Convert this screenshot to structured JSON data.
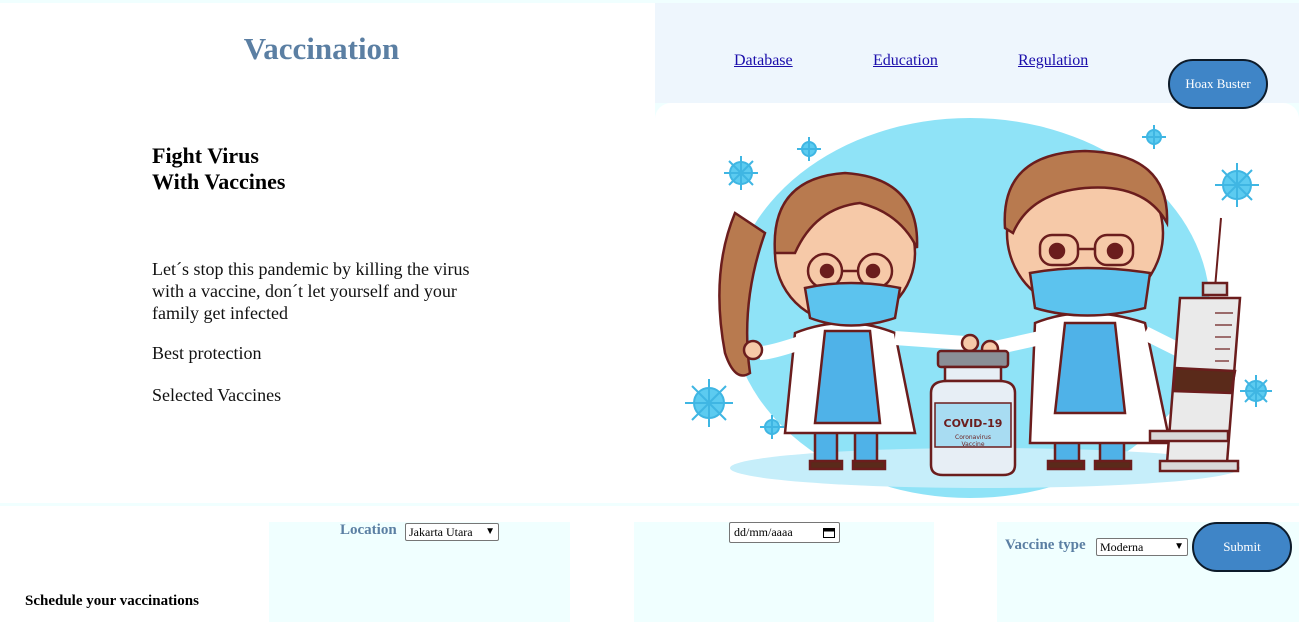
{
  "header": {
    "title": "Vaccination"
  },
  "nav": {
    "links": [
      "Database",
      "Education",
      "Regulation"
    ],
    "hoax_button": "Hoax Buster"
  },
  "hero": {
    "headline_line1": "Fight Virus",
    "headline_line2": "With Vaccines",
    "intro": "Let´s stop this pandemic by killing the virus with a vaccine, don´t let yourself and your family get infected",
    "best_protection": "Best protection",
    "selected_vaccines": "Selected Vaccines",
    "illustration": {
      "vial_label": "COVID-19",
      "vial_sublabel1": "Coronavirus",
      "vial_sublabel2": "Vaccine"
    }
  },
  "booking": {
    "schedule_label": "Schedule your vaccinations",
    "location_label": "Location",
    "location_value": "Jakarta Utara",
    "date_placeholder": "dd/mm/aaaa",
    "vaccine_type_label": "Vaccine type",
    "vaccine_type_value": "Moderna",
    "submit_label": "Submit"
  },
  "colors": {
    "title_color": "#5b7fa3",
    "button_color": "#3f85c7",
    "panel_bg": "#f0ffff",
    "nav_bg": "#eef6fd"
  }
}
